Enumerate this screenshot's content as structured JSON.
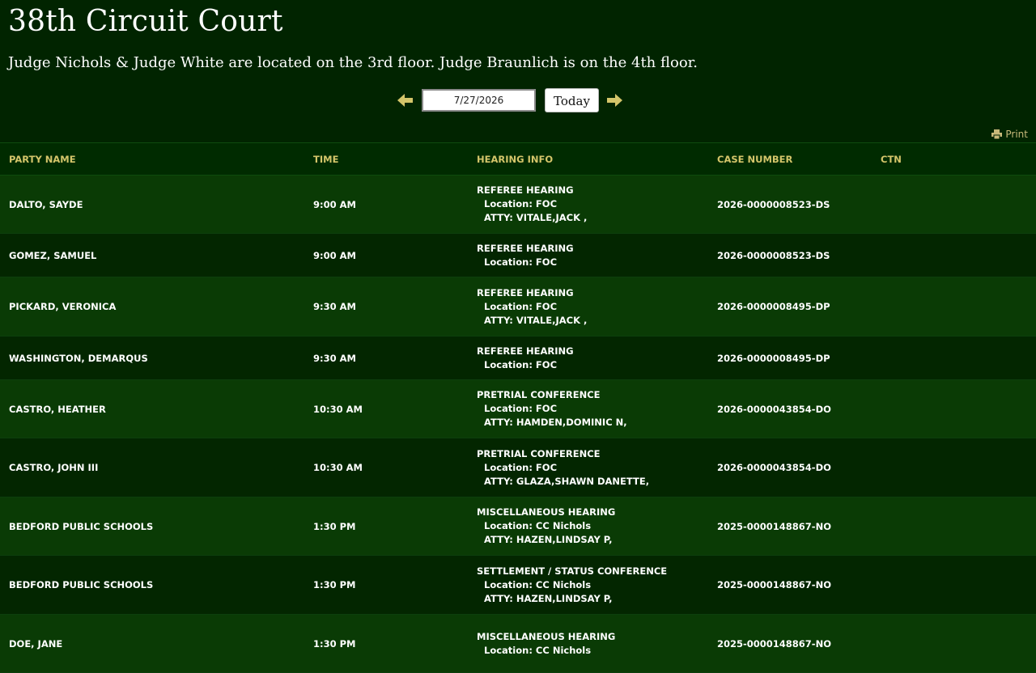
{
  "header": {
    "title": "38th Circuit Court",
    "subtitle": "Judge Nichols & Judge White are located on the 3rd floor. Judge Braunlich is on the 4th floor."
  },
  "datebar": {
    "date_value": "7/27/2026",
    "today_label": "Today",
    "prev_icon": "arrow-left-icon",
    "next_icon": "arrow-right-icon"
  },
  "print": {
    "label": "Print",
    "icon": "printer-icon"
  },
  "colors": {
    "background": "#012400",
    "row_light": "#0a3b05",
    "row_dark": "#032600",
    "header_text": "#d4c56a",
    "arrow": "#d4c56a"
  },
  "table": {
    "columns": [
      "PARTY NAME",
      "TIME",
      "HEARING INFO",
      "CASE NUMBER",
      "CTN"
    ],
    "rows": [
      {
        "party": "DALTO, SAYDE",
        "time": "9:00 AM",
        "type": "REFEREE HEARING",
        "location": "Location: FOC",
        "atty": "ATTY: VITALE,JACK ,",
        "case": "2026-0000008523-DS",
        "ctn": ""
      },
      {
        "party": "GOMEZ, SAMUEL",
        "time": "9:00 AM",
        "type": "REFEREE HEARING",
        "location": "Location: FOC",
        "atty": "",
        "case": "2026-0000008523-DS",
        "ctn": ""
      },
      {
        "party": "PICKARD, VERONICA",
        "time": "9:30 AM",
        "type": "REFEREE HEARING",
        "location": "Location: FOC",
        "atty": "ATTY: VITALE,JACK ,",
        "case": "2026-0000008495-DP",
        "ctn": ""
      },
      {
        "party": "WASHINGTON, DEMARQUS",
        "time": "9:30 AM",
        "type": "REFEREE HEARING",
        "location": "Location: FOC",
        "atty": "",
        "case": "2026-0000008495-DP",
        "ctn": ""
      },
      {
        "party": "CASTRO, HEATHER",
        "time": "10:30 AM",
        "type": "PRETRIAL CONFERENCE",
        "location": "Location: FOC",
        "atty": "ATTY: HAMDEN,DOMINIC N,",
        "case": "2026-0000043854-DO",
        "ctn": ""
      },
      {
        "party": "CASTRO, JOHN III",
        "time": "10:30 AM",
        "type": "PRETRIAL CONFERENCE",
        "location": "Location: FOC",
        "atty": "ATTY: GLAZA,SHAWN DANETTE,",
        "case": "2026-0000043854-DO",
        "ctn": ""
      },
      {
        "party": "BEDFORD PUBLIC SCHOOLS",
        "time": "1:30 PM",
        "type": "MISCELLANEOUS HEARING",
        "location": "Location: CC Nichols",
        "atty": "ATTY: HAZEN,LINDSAY P,",
        "case": "2025-0000148867-NO",
        "ctn": ""
      },
      {
        "party": "BEDFORD PUBLIC SCHOOLS",
        "time": "1:30 PM",
        "type": "SETTLEMENT / STATUS CONFERENCE",
        "location": "Location: CC Nichols",
        "atty": "ATTY: HAZEN,LINDSAY P,",
        "case": "2025-0000148867-NO",
        "ctn": ""
      },
      {
        "party": "DOE, JANE",
        "time": "1:30 PM",
        "type": "MISCELLANEOUS HEARING",
        "location": "Location: CC Nichols",
        "atty": "",
        "case": "2025-0000148867-NO",
        "ctn": ""
      }
    ]
  }
}
